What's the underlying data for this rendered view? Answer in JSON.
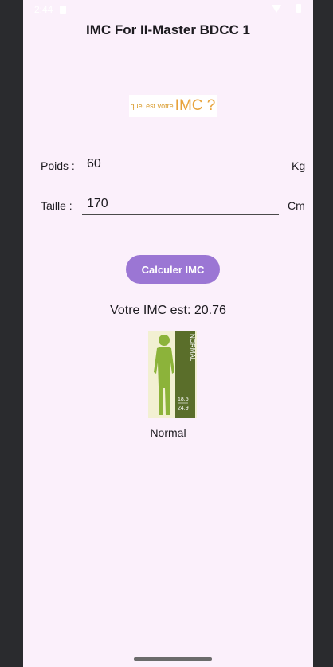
{
  "status_bar": {
    "time": "2:44"
  },
  "app": {
    "title": "IMC For II-Master BDCC 1"
  },
  "logo": {
    "small_text": "quel est votre",
    "big_text": "IMC ?"
  },
  "form": {
    "weight": {
      "label": "Poids :",
      "value": "60",
      "unit": "Kg"
    },
    "height": {
      "label": "Taille :",
      "value": "170",
      "unit": "Cm"
    }
  },
  "button": {
    "label": "Calculer IMC"
  },
  "result": {
    "text": "Votre IMC est: 20.76"
  },
  "bmi_figure": {
    "category_vertical": "NORMAL",
    "range_low": "18.5",
    "range_high": "24.9"
  },
  "category": {
    "label": "Normal"
  },
  "colors": {
    "accent": "#9b76d4",
    "background": "#fbf0fb",
    "figure_green": "#8cb33a",
    "figure_dark": "#5a6e2a"
  }
}
